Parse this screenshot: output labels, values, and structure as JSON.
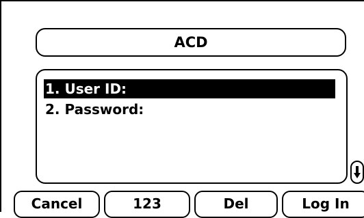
{
  "header": {
    "title": "ACD"
  },
  "list": {
    "items": [
      {
        "label": "1. User ID:",
        "selected": true
      },
      {
        "label": "2. Password:",
        "selected": false
      }
    ]
  },
  "scroll": {
    "icon": "scroll-down-icon"
  },
  "softkeys": [
    {
      "label": "Cancel"
    },
    {
      "label": "123"
    },
    {
      "label": "Del"
    },
    {
      "label": "Log In"
    }
  ]
}
